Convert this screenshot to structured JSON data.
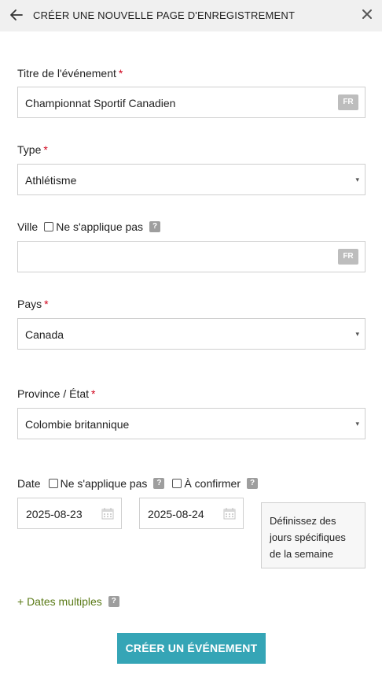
{
  "header": {
    "title": "CRÉER UNE NOUVELLE PAGE D'ENREGISTREMENT"
  },
  "form": {
    "title_field": {
      "label": "Titre de l'événement",
      "required_mark": "*",
      "value": "Championnat Sportif Canadien",
      "lang_badge": "FR"
    },
    "type_field": {
      "label": "Type",
      "required_mark": "*",
      "value": "Athlétisme",
      "caret": "▾"
    },
    "city_field": {
      "label": "Ville",
      "not_applicable_label": "Ne s'applique pas",
      "not_applicable_checked": false,
      "help": "?",
      "value": "",
      "lang_badge": "FR"
    },
    "country_field": {
      "label": "Pays",
      "required_mark": "*",
      "value": "Canada",
      "caret": "▾"
    },
    "province_field": {
      "label": "Province / État",
      "required_mark": "*",
      "value": "Colombie britannique",
      "caret": "▾"
    },
    "date_field": {
      "label": "Date",
      "not_applicable_label": "Ne s'applique pas",
      "not_applicable_checked": false,
      "to_confirm_label": "À confirmer",
      "to_confirm_checked": false,
      "help": "?",
      "start_date": "2025-08-23",
      "end_date": "2025-08-24",
      "specific_days_text": "Définissez des jours spécifiques de la semaine"
    },
    "multiple_dates": {
      "label": "+ Dates multiples",
      "help": "?"
    },
    "submit_label": "CRÉER UN ÉVÉNEMENT"
  },
  "icons": {
    "back": "arrow-left-icon",
    "close": "close-icon",
    "calendar": "calendar-icon"
  },
  "colors": {
    "header_bg": "#f0f0f0",
    "required": "#d0021b",
    "link_green": "#5a7a16",
    "button_teal": "#35a5b6",
    "badge_gray": "#bdbdbd"
  }
}
